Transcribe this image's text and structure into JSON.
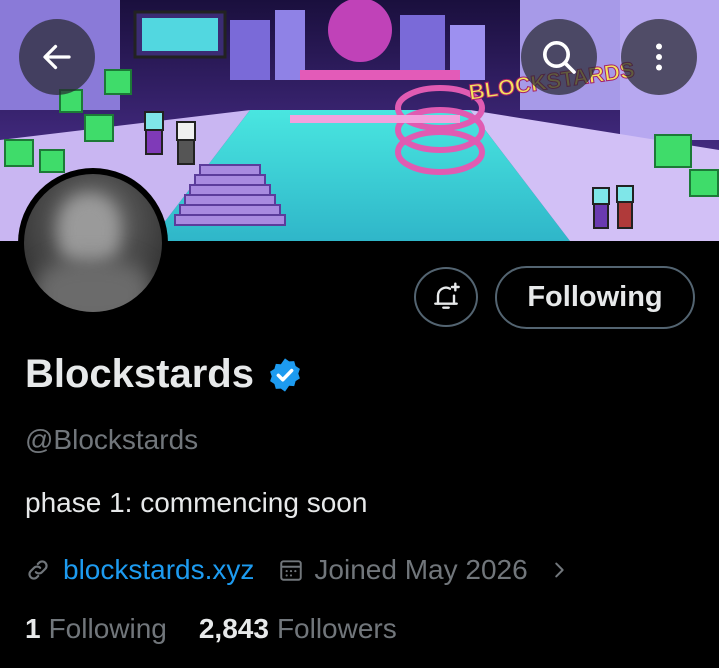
{
  "header": {
    "back_icon": "arrow-left-icon",
    "search_icon": "search-icon",
    "more_icon": "more-vertical-icon",
    "banner_sign_text": "BLOCKSTARDS"
  },
  "profile": {
    "display_name": "Blockstards",
    "verified": true,
    "handle": "@Blockstards",
    "bio": "phase 1: commencing soon",
    "website": "blockstards.xyz",
    "joined": "Joined May 2026"
  },
  "actions": {
    "notify_icon": "bell-plus-icon",
    "follow_label": "Following"
  },
  "stats": {
    "following_count": "1",
    "following_label": "Following",
    "followers_count": "2,843",
    "followers_label": "Followers"
  },
  "colors": {
    "background": "#000000",
    "link": "#1d9bf0",
    "verified": "#1d9bf0",
    "muted_text": "#71767b",
    "primary_text": "#e7e9ea"
  }
}
